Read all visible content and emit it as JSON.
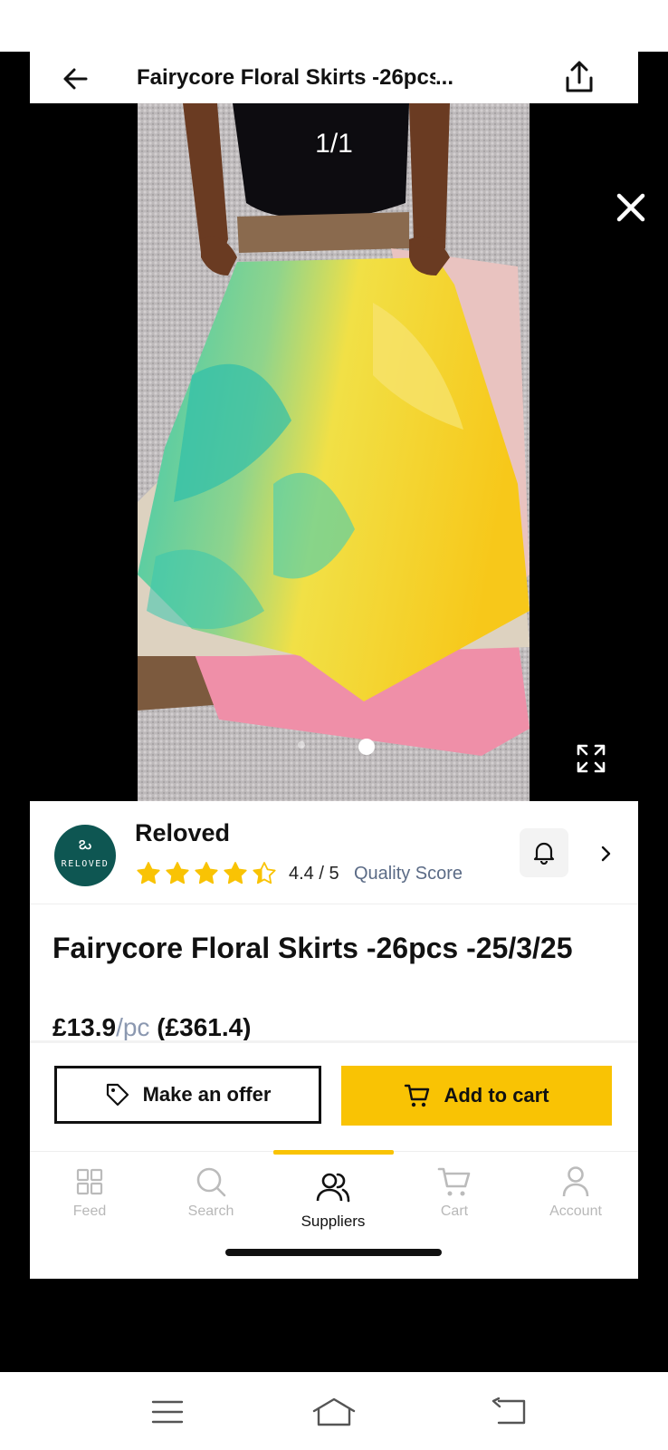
{
  "header": {
    "title": "Fairycore Floral Skirts -26pcs -",
    "title_ellipsis": "..."
  },
  "media": {
    "counter": "1/1",
    "slide_count": 2,
    "active_slide": 2
  },
  "seller": {
    "name": "Reloved",
    "logo_text": "RELOVED",
    "logo_glyph": "ఒ",
    "rating_value": 4.4,
    "rating_text": "4.4 / 5",
    "quality_label": "Quality Score"
  },
  "product": {
    "title": "Fairycore Floral Skirts -26pcs -25/3/25",
    "price_unit_price": "£13.9",
    "price_unit_suffix": "/pc",
    "price_total": "(£361.4)"
  },
  "actions": {
    "offer_label": "Make an offer",
    "cart_label": "Add to cart"
  },
  "nav": {
    "items": [
      {
        "label": "Feed",
        "icon": "grid-icon"
      },
      {
        "label": "Search",
        "icon": "search-icon"
      },
      {
        "label": "Suppliers",
        "icon": "users-icon"
      },
      {
        "label": "Cart",
        "icon": "cart-icon"
      },
      {
        "label": "Account",
        "icon": "user-icon"
      }
    ],
    "active": "Suppliers"
  },
  "colors": {
    "accent": "#f9c304",
    "logo_bg": "#0e5652",
    "quality_text": "#5b6b86"
  }
}
